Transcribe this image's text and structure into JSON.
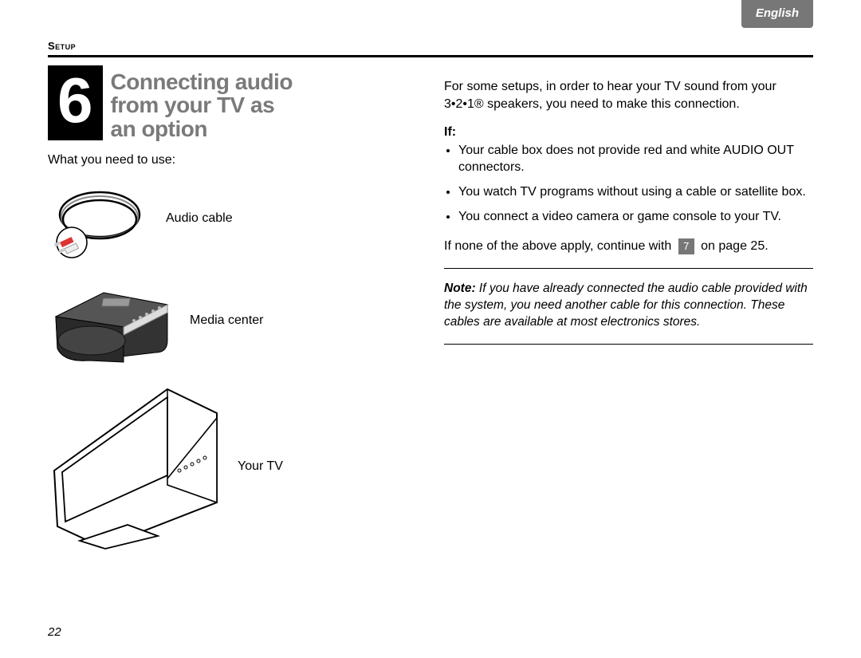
{
  "lang_tab": "English",
  "section_header": "Setup",
  "step": {
    "number": "6",
    "title_line1": "Connecting audio",
    "title_line2": "from your TV as",
    "title_line3": "an option"
  },
  "intro": "What you need to use:",
  "items": {
    "audio_cable": "Audio cable",
    "media_center": "Media center",
    "tv": "Your TV"
  },
  "right": {
    "para1": "For some setups, in order to hear your TV sound from your 3•2•1® speakers, you need to make this connection.",
    "if_head": "If:",
    "bullets": [
      "Your cable box does not provide red and white AUDIO OUT connectors.",
      "You watch TV programs without using a cable or satellite box.",
      "You connect a video camera or game console to your TV."
    ],
    "continue_pre": "If none of the above apply, continue with",
    "continue_ref": "7",
    "continue_post": "on page 25.",
    "note_label": "Note:",
    "note_body": "If you have already connected the audio cable provided with the system, you need another cable for this connection. These cables are available at most electronics stores."
  },
  "page_number": "22"
}
